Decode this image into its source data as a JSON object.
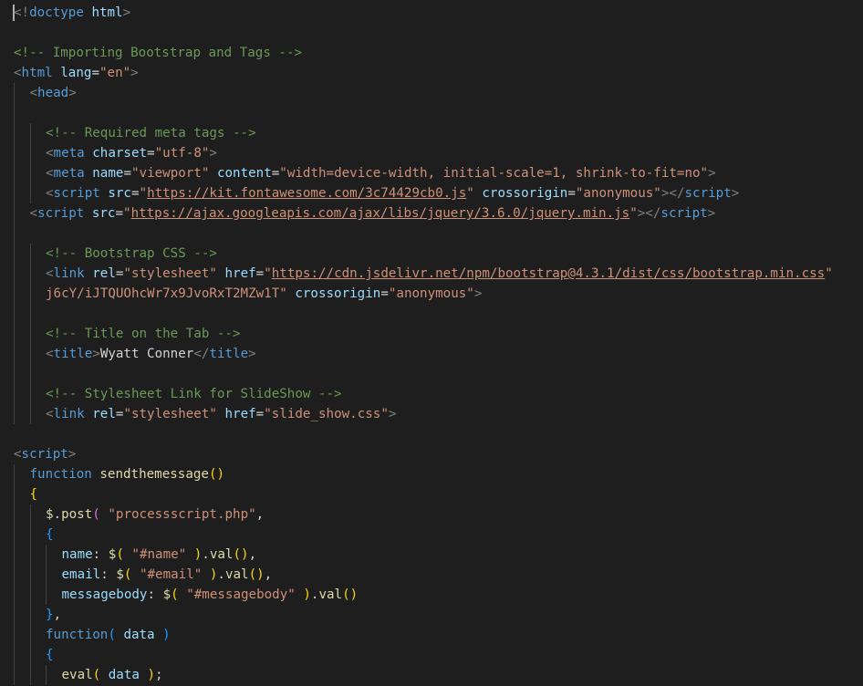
{
  "editor": {
    "lines": [
      {
        "indent": 0,
        "tokens": [
          {
            "t": "<!",
            "c": "tag"
          },
          {
            "t": "doctype",
            "c": "name"
          },
          {
            "t": " ",
            "c": "text"
          },
          {
            "t": "html",
            "c": "attr"
          },
          {
            "t": ">",
            "c": "tag"
          }
        ]
      },
      {
        "indent": 0,
        "tokens": []
      },
      {
        "indent": 0,
        "tokens": [
          {
            "t": "<!-- Importing Bootstrap and Tags -->",
            "c": "cmt"
          }
        ]
      },
      {
        "indent": 0,
        "tokens": [
          {
            "t": "<",
            "c": "tag"
          },
          {
            "t": "html",
            "c": "name"
          },
          {
            "t": " ",
            "c": "text"
          },
          {
            "t": "lang",
            "c": "attr"
          },
          {
            "t": "=",
            "c": "text"
          },
          {
            "t": "\"en\"",
            "c": "str"
          },
          {
            "t": ">",
            "c": "tag"
          }
        ]
      },
      {
        "indent": 1,
        "tokens": [
          {
            "t": "<",
            "c": "tag"
          },
          {
            "t": "head",
            "c": "name"
          },
          {
            "t": ">",
            "c": "tag"
          }
        ]
      },
      {
        "indent": 0,
        "tokens": []
      },
      {
        "indent": 2,
        "tokens": [
          {
            "t": "<!-- Required meta tags -->",
            "c": "cmt"
          }
        ]
      },
      {
        "indent": 2,
        "tokens": [
          {
            "t": "<",
            "c": "tag"
          },
          {
            "t": "meta",
            "c": "name"
          },
          {
            "t": " ",
            "c": "text"
          },
          {
            "t": "charset",
            "c": "attr"
          },
          {
            "t": "=",
            "c": "text"
          },
          {
            "t": "\"utf-8\"",
            "c": "str"
          },
          {
            "t": ">",
            "c": "tag"
          }
        ]
      },
      {
        "indent": 2,
        "tokens": [
          {
            "t": "<",
            "c": "tag"
          },
          {
            "t": "meta",
            "c": "name"
          },
          {
            "t": " ",
            "c": "text"
          },
          {
            "t": "name",
            "c": "attr"
          },
          {
            "t": "=",
            "c": "text"
          },
          {
            "t": "\"viewport\"",
            "c": "str"
          },
          {
            "t": " ",
            "c": "text"
          },
          {
            "t": "content",
            "c": "attr"
          },
          {
            "t": "=",
            "c": "text"
          },
          {
            "t": "\"width=device-width, initial-scale=1, shrink-to-fit=no\"",
            "c": "str"
          },
          {
            "t": ">",
            "c": "tag"
          }
        ]
      },
      {
        "indent": 2,
        "tokens": [
          {
            "t": "<",
            "c": "tag"
          },
          {
            "t": "script",
            "c": "name"
          },
          {
            "t": " ",
            "c": "text"
          },
          {
            "t": "src",
            "c": "attr"
          },
          {
            "t": "=",
            "c": "text"
          },
          {
            "t": "\"",
            "c": "str"
          },
          {
            "t": "https://kit.fontawesome.com/3c74429cb0.js",
            "c": "url"
          },
          {
            "t": "\"",
            "c": "str"
          },
          {
            "t": " ",
            "c": "text"
          },
          {
            "t": "crossorigin",
            "c": "attr"
          },
          {
            "t": "=",
            "c": "text"
          },
          {
            "t": "\"anonymous\"",
            "c": "str"
          },
          {
            "t": "></",
            "c": "tag"
          },
          {
            "t": "script",
            "c": "name"
          },
          {
            "t": ">",
            "c": "tag"
          }
        ]
      },
      {
        "indent": 1,
        "tokens": [
          {
            "t": "<",
            "c": "tag"
          },
          {
            "t": "script",
            "c": "name"
          },
          {
            "t": " ",
            "c": "text"
          },
          {
            "t": "src",
            "c": "attr"
          },
          {
            "t": "=",
            "c": "text"
          },
          {
            "t": "\"",
            "c": "str"
          },
          {
            "t": "https://ajax.googleapis.com/ajax/libs/jquery/3.6.0/jquery.min.js",
            "c": "url"
          },
          {
            "t": "\"",
            "c": "str"
          },
          {
            "t": "></",
            "c": "tag"
          },
          {
            "t": "script",
            "c": "name"
          },
          {
            "t": ">",
            "c": "tag"
          }
        ]
      },
      {
        "indent": 0,
        "tokens": []
      },
      {
        "indent": 2,
        "tokens": [
          {
            "t": "<!-- Bootstrap CSS -->",
            "c": "cmt"
          }
        ]
      },
      {
        "indent": 2,
        "tokens": [
          {
            "t": "<",
            "c": "tag"
          },
          {
            "t": "link",
            "c": "name"
          },
          {
            "t": " ",
            "c": "text"
          },
          {
            "t": "rel",
            "c": "attr"
          },
          {
            "t": "=",
            "c": "text"
          },
          {
            "t": "\"stylesheet\"",
            "c": "str"
          },
          {
            "t": " ",
            "c": "text"
          },
          {
            "t": "href",
            "c": "attr"
          },
          {
            "t": "=",
            "c": "text"
          },
          {
            "t": "\"",
            "c": "str"
          },
          {
            "t": "https://cdn.jsdelivr.net/npm/bootstrap@4.3.1/dist/css/bootstrap.min.css",
            "c": "url"
          },
          {
            "t": "\"",
            "c": "str"
          }
        ]
      },
      {
        "indent": 2,
        "tokens": [
          {
            "t": "j6cY/iJTQUOhcWr7x9JvoRxT2MZw1T\"",
            "c": "str"
          },
          {
            "t": " ",
            "c": "text"
          },
          {
            "t": "crossorigin",
            "c": "attr"
          },
          {
            "t": "=",
            "c": "text"
          },
          {
            "t": "\"anonymous\"",
            "c": "str"
          },
          {
            "t": ">",
            "c": "tag"
          }
        ]
      },
      {
        "indent": 0,
        "tokens": []
      },
      {
        "indent": 2,
        "tokens": [
          {
            "t": "<!-- Title on the Tab -->",
            "c": "cmt"
          }
        ]
      },
      {
        "indent": 2,
        "tokens": [
          {
            "t": "<",
            "c": "tag"
          },
          {
            "t": "title",
            "c": "name"
          },
          {
            "t": ">",
            "c": "tag"
          },
          {
            "t": "Wyatt Conner",
            "c": "text"
          },
          {
            "t": "</",
            "c": "tag"
          },
          {
            "t": "title",
            "c": "name"
          },
          {
            "t": ">",
            "c": "tag"
          }
        ]
      },
      {
        "indent": 0,
        "tokens": []
      },
      {
        "indent": 2,
        "tokens": [
          {
            "t": "<!-- Stylesheet Link for SlideShow -->",
            "c": "cmt"
          }
        ]
      },
      {
        "indent": 2,
        "tokens": [
          {
            "t": "<",
            "c": "tag"
          },
          {
            "t": "link",
            "c": "name"
          },
          {
            "t": " ",
            "c": "text"
          },
          {
            "t": "rel",
            "c": "attr"
          },
          {
            "t": "=",
            "c": "text"
          },
          {
            "t": "\"stylesheet\"",
            "c": "str"
          },
          {
            "t": " ",
            "c": "text"
          },
          {
            "t": "href",
            "c": "attr"
          },
          {
            "t": "=",
            "c": "text"
          },
          {
            "t": "\"slide_show.css\"",
            "c": "str"
          },
          {
            "t": ">",
            "c": "tag"
          }
        ]
      },
      {
        "indent": 0,
        "tokens": []
      },
      {
        "indent": 0,
        "tokens": [
          {
            "t": "<",
            "c": "tag"
          },
          {
            "t": "script",
            "c": "name"
          },
          {
            "t": ">",
            "c": "tag"
          }
        ]
      },
      {
        "indent": 1,
        "tokens": [
          {
            "t": "function",
            "c": "name"
          },
          {
            "t": " ",
            "c": "text"
          },
          {
            "t": "sendthemessage",
            "c": "fn"
          },
          {
            "t": "()",
            "c": "br1"
          }
        ]
      },
      {
        "indent": 1,
        "tokens": [
          {
            "t": "{",
            "c": "br1"
          }
        ]
      },
      {
        "indent": 2,
        "tokens": [
          {
            "t": "$",
            "c": "fn"
          },
          {
            "t": ".",
            "c": "text"
          },
          {
            "t": "post",
            "c": "fn"
          },
          {
            "t": "(",
            "c": "br2"
          },
          {
            "t": " ",
            "c": "text"
          },
          {
            "t": "\"processscript.php\"",
            "c": "str"
          },
          {
            "t": ",",
            "c": "text"
          }
        ]
      },
      {
        "indent": 2,
        "tokens": [
          {
            "t": "{",
            "c": "br3"
          }
        ]
      },
      {
        "indent": 3,
        "tokens": [
          {
            "t": "name",
            "c": "attr"
          },
          {
            "t": ": ",
            "c": "text"
          },
          {
            "t": "$",
            "c": "fn"
          },
          {
            "t": "(",
            "c": "br1"
          },
          {
            "t": " ",
            "c": "text"
          },
          {
            "t": "\"#name\"",
            "c": "str"
          },
          {
            "t": " ",
            "c": "text"
          },
          {
            "t": ")",
            "c": "br1"
          },
          {
            "t": ".",
            "c": "text"
          },
          {
            "t": "val",
            "c": "fn"
          },
          {
            "t": "()",
            "c": "br1"
          },
          {
            "t": ",",
            "c": "text"
          }
        ]
      },
      {
        "indent": 3,
        "tokens": [
          {
            "t": "email",
            "c": "attr"
          },
          {
            "t": ": ",
            "c": "text"
          },
          {
            "t": "$",
            "c": "fn"
          },
          {
            "t": "(",
            "c": "br1"
          },
          {
            "t": " ",
            "c": "text"
          },
          {
            "t": "\"#email\"",
            "c": "str"
          },
          {
            "t": " ",
            "c": "text"
          },
          {
            "t": ")",
            "c": "br1"
          },
          {
            "t": ".",
            "c": "text"
          },
          {
            "t": "val",
            "c": "fn"
          },
          {
            "t": "()",
            "c": "br1"
          },
          {
            "t": ",",
            "c": "text"
          }
        ]
      },
      {
        "indent": 3,
        "tokens": [
          {
            "t": "messagebody",
            "c": "attr"
          },
          {
            "t": ": ",
            "c": "text"
          },
          {
            "t": "$",
            "c": "fn"
          },
          {
            "t": "(",
            "c": "br1"
          },
          {
            "t": " ",
            "c": "text"
          },
          {
            "t": "\"#messagebody\"",
            "c": "str"
          },
          {
            "t": " ",
            "c": "text"
          },
          {
            "t": ")",
            "c": "br1"
          },
          {
            "t": ".",
            "c": "text"
          },
          {
            "t": "val",
            "c": "fn"
          },
          {
            "t": "()",
            "c": "br1"
          }
        ]
      },
      {
        "indent": 2,
        "tokens": [
          {
            "t": "}",
            "c": "br3"
          },
          {
            "t": ",",
            "c": "text"
          }
        ]
      },
      {
        "indent": 2,
        "tokens": [
          {
            "t": "function",
            "c": "name"
          },
          {
            "t": "(",
            "c": "br3"
          },
          {
            "t": " ",
            "c": "text"
          },
          {
            "t": "data",
            "c": "attr"
          },
          {
            "t": " ",
            "c": "text"
          },
          {
            "t": ")",
            "c": "br3"
          }
        ]
      },
      {
        "indent": 2,
        "tokens": [
          {
            "t": "{",
            "c": "br3"
          }
        ]
      },
      {
        "indent": 3,
        "tokens": [
          {
            "t": "eval",
            "c": "fn"
          },
          {
            "t": "(",
            "c": "br1"
          },
          {
            "t": " ",
            "c": "text"
          },
          {
            "t": "data",
            "c": "attr"
          },
          {
            "t": " ",
            "c": "text"
          },
          {
            "t": ")",
            "c": "br1"
          },
          {
            "t": ";",
            "c": "text"
          }
        ]
      }
    ]
  },
  "colors": {
    "background": "#1e1e1e",
    "tag_punctuation": "#808080",
    "tag_name_keyword": "#569cd6",
    "attribute_variable": "#9cdcfe",
    "string": "#ce9178",
    "comment": "#6a9955",
    "function": "#dcdcaa",
    "bracket_gold": "#ffd700",
    "bracket_orchid": "#da70d6",
    "bracket_blue": "#179fff"
  }
}
